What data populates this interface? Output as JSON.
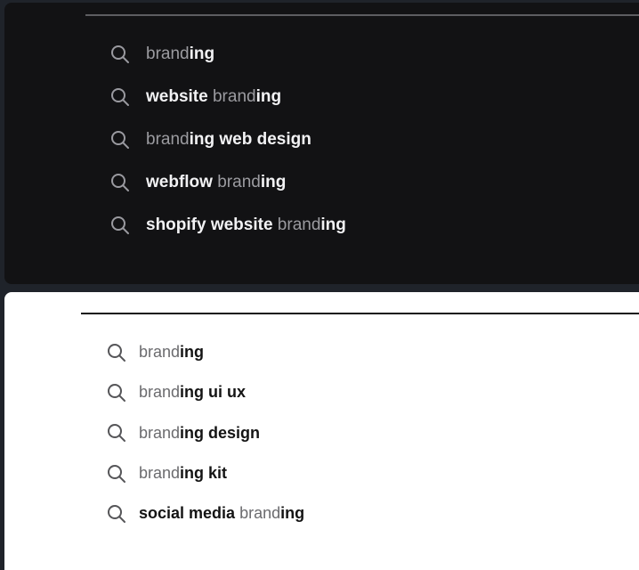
{
  "dark_panel": {
    "suggestions": [
      [
        {
          "text": "brand",
          "style": "dim"
        },
        {
          "text": "ing",
          "style": "bold"
        }
      ],
      [
        {
          "text": "website",
          "style": "bold"
        },
        {
          "text": " brand",
          "style": "dim"
        },
        {
          "text": "ing",
          "style": "bold"
        }
      ],
      [
        {
          "text": "brand",
          "style": "dim"
        },
        {
          "text": "ing web design",
          "style": "bold"
        }
      ],
      [
        {
          "text": "webflow",
          "style": "bold"
        },
        {
          "text": " brand",
          "style": "dim"
        },
        {
          "text": "ing",
          "style": "bold"
        }
      ],
      [
        {
          "text": "shopify website",
          "style": "bold"
        },
        {
          "text": " brand",
          "style": "dim"
        },
        {
          "text": "ing",
          "style": "bold"
        }
      ]
    ]
  },
  "light_panel": {
    "suggestions": [
      [
        {
          "text": "brand",
          "style": "dim"
        },
        {
          "text": "ing",
          "style": "bold"
        }
      ],
      [
        {
          "text": "brand",
          "style": "dim"
        },
        {
          "text": "ing ui ux",
          "style": "bold"
        }
      ],
      [
        {
          "text": "brand",
          "style": "dim"
        },
        {
          "text": "ing design",
          "style": "bold"
        }
      ],
      [
        {
          "text": "brand",
          "style": "dim"
        },
        {
          "text": "ing kit",
          "style": "bold"
        }
      ],
      [
        {
          "text": "social media",
          "style": "bold"
        },
        {
          "text": " brand",
          "style": "dim"
        },
        {
          "text": "ing",
          "style": "bold"
        }
      ]
    ]
  },
  "icons": {
    "suggestion_icon": "search-icon"
  },
  "colors": {
    "page_background": "#1f232a",
    "dark_panel_background": "#121214",
    "light_panel_background": "#ffffff",
    "dark_text_bold": "#f2f2f4",
    "dark_text_dim": "#9b9ba0",
    "light_text_bold": "#141414",
    "light_text_dim": "#6b6b6e"
  }
}
